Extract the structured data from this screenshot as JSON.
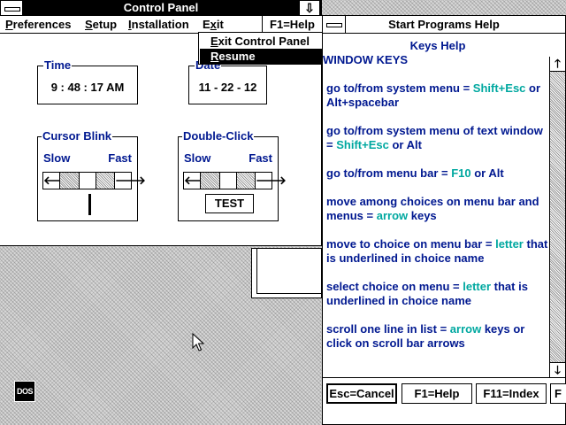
{
  "control_panel": {
    "title": "Control Panel",
    "menu": {
      "preferences": "Preferences",
      "setup": "Setup",
      "installation": "Installation",
      "exit": "Exit",
      "help": "F1=Help"
    },
    "exit_menu": {
      "exit_control_panel": "Exit Control Panel",
      "resume": "Resume"
    },
    "time": {
      "label": "Time",
      "value": "9 : 48 : 17 AM"
    },
    "date": {
      "label": "Date",
      "value": "11 - 22 - 12"
    },
    "cursor_blink": {
      "label": "Cursor Blink",
      "slow": "Slow",
      "fast": "Fast"
    },
    "double_click": {
      "label": "Double-Click",
      "slow": "Slow",
      "fast": "Fast",
      "test": "TEST"
    }
  },
  "help_window": {
    "title": "Start Programs Help",
    "heading": "Keys Help",
    "section": "WINDOW KEYS",
    "lines": [
      {
        "a": "go to/from system menu = ",
        "k": "Shift+Esc",
        "b": " or Alt+spacebar"
      },
      {
        "a": "go to/from system menu of text window = ",
        "k": "Shift+Esc",
        "b": " or Alt"
      },
      {
        "a": "go to/from menu bar = ",
        "k": "F10",
        "b": " or Alt"
      },
      {
        "a": "move among choices on menu bar and menus = ",
        "k": "arrow",
        "b": " keys"
      },
      {
        "a": "move to choice on menu bar = ",
        "k": "letter",
        "b": " that is underlined in choice name"
      },
      {
        "a": "select choice on menu = ",
        "k": "letter",
        "b": " that is underlined in choice name"
      },
      {
        "a": "scroll one line in list = ",
        "k": "arrow",
        "b": " keys or click on scroll bar arrows"
      }
    ],
    "buttons": {
      "cancel": "Esc=Cancel",
      "help": "F1=Help",
      "index": "F11=Index",
      "more": "F"
    }
  },
  "desktop": {
    "dos_icon": "DOS"
  },
  "icons": {
    "system_menu": "system-menu-icon",
    "minimize": "down-arrow-icon",
    "scroll_left": "left-arrow-icon",
    "scroll_right": "right-arrow-icon",
    "scroll_up": "up-arrow-icon",
    "scroll_down": "down-arrow-icon",
    "pointer": "mouse-pointer-icon"
  },
  "colors": {
    "label_blue": "#001890",
    "key_teal": "#00a8a0"
  }
}
